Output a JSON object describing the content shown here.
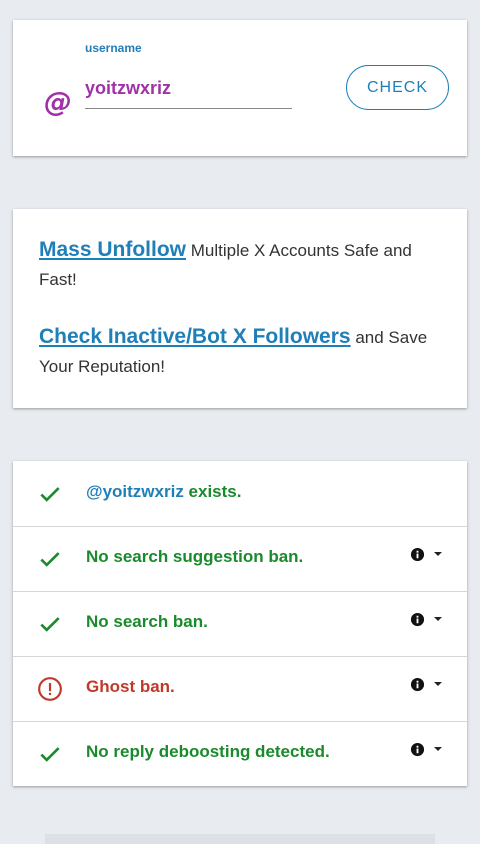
{
  "search": {
    "label": "username",
    "value": "yoitzwxriz",
    "prefix_icon": "at-icon",
    "check_label": "CHECK"
  },
  "promo": {
    "line1_link": "Mass Unfollow",
    "line1_text": " Multiple X Accounts Safe and Fast!",
    "line2_link": "Check Inactive/Bot X Followers",
    "line2_text": " and Save Your Reputation!"
  },
  "results": [
    {
      "status": "ok",
      "handle": "@yoitzwxriz",
      "text": " exists."
    },
    {
      "status": "ok",
      "text": "No search suggestion ban.",
      "has_info": true
    },
    {
      "status": "ok",
      "text": "No search ban.",
      "has_info": true
    },
    {
      "status": "warn",
      "text": "Ghost ban.",
      "has_info": true
    },
    {
      "status": "ok",
      "text": "No reply deboosting detected.",
      "has_info": true
    }
  ],
  "colors": {
    "accent": "#1f7fb8",
    "username": "#a031a8",
    "ok": "#1a8a2c",
    "warn": "#c0392b"
  }
}
